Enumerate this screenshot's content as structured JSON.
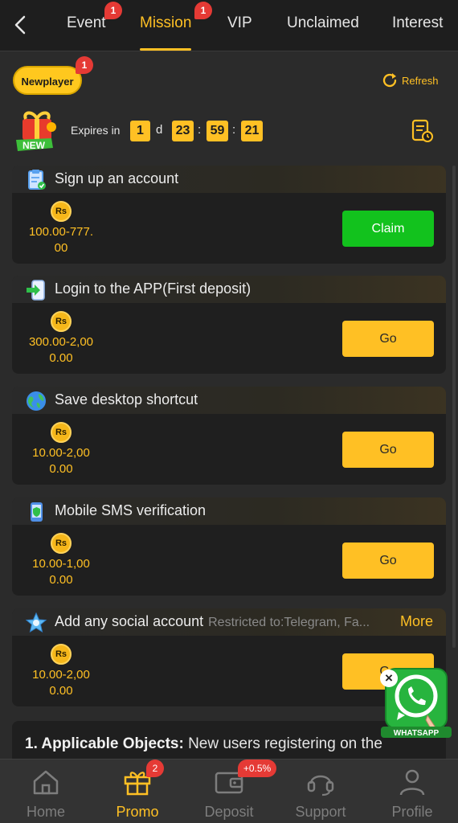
{
  "tabs": [
    {
      "label": "Event",
      "badge": "1"
    },
    {
      "label": "Mission",
      "badge": "1",
      "active": true
    },
    {
      "label": "VIP"
    },
    {
      "label": "Unclaimed"
    },
    {
      "label": "Interest"
    }
  ],
  "header": {
    "newplayer_label": "Newplayer",
    "newplayer_badge": "1",
    "refresh_label": "Refresh",
    "new_tag": "NEW"
  },
  "countdown": {
    "label": "Expires in",
    "days": "1",
    "days_unit": "d",
    "hours": "23",
    "minutes": "59",
    "seconds": "21",
    "separator": ":"
  },
  "currency_symbol": "Rs",
  "missions": [
    {
      "title": "Sign up an account",
      "amount_line1": "100.00-777.",
      "amount_line2": "00",
      "button": "Claim",
      "icon": "clipboard-icon"
    },
    {
      "title": "Login to the APP(First deposit)",
      "amount_line1": "300.00-2,00",
      "amount_line2": "0.00",
      "button": "Go",
      "icon": "login-phone-icon"
    },
    {
      "title": "Save desktop shortcut",
      "amount_line1": "10.00-2,00",
      "amount_line2": "0.00",
      "button": "Go",
      "icon": "globe-icon"
    },
    {
      "title": "Mobile SMS verification",
      "amount_line1": "10.00-1,00",
      "amount_line2": "0.00",
      "button": "Go",
      "icon": "mobile-shield-icon"
    },
    {
      "title": "Add any social account",
      "subtitle": "Restricted to:Telegram, Fa...",
      "more": "More",
      "amount_line1": "10.00-2,00",
      "amount_line2": "0.00",
      "button": "Go",
      "icon": "social-star-icon"
    }
  ],
  "rules": {
    "heading": "1. Applicable Objects:",
    "text": "New users registering on the"
  },
  "whatsapp": {
    "label": "WHATSAPP",
    "close": "×"
  },
  "bottom_nav": [
    {
      "label": "Home",
      "icon": "home-icon"
    },
    {
      "label": "Promo",
      "icon": "gift-icon",
      "badge": "2",
      "active": true
    },
    {
      "label": "Deposit",
      "icon": "wallet-icon",
      "badge": "+0.5%"
    },
    {
      "label": "Support",
      "icon": "headset-icon"
    },
    {
      "label": "Profile",
      "icon": "person-icon"
    }
  ],
  "colors": {
    "accent": "#ffc024",
    "claim_green": "#12c21d",
    "badge_red": "#e53a35",
    "background": "#2b2b2b",
    "card": "#1f1f1f"
  }
}
